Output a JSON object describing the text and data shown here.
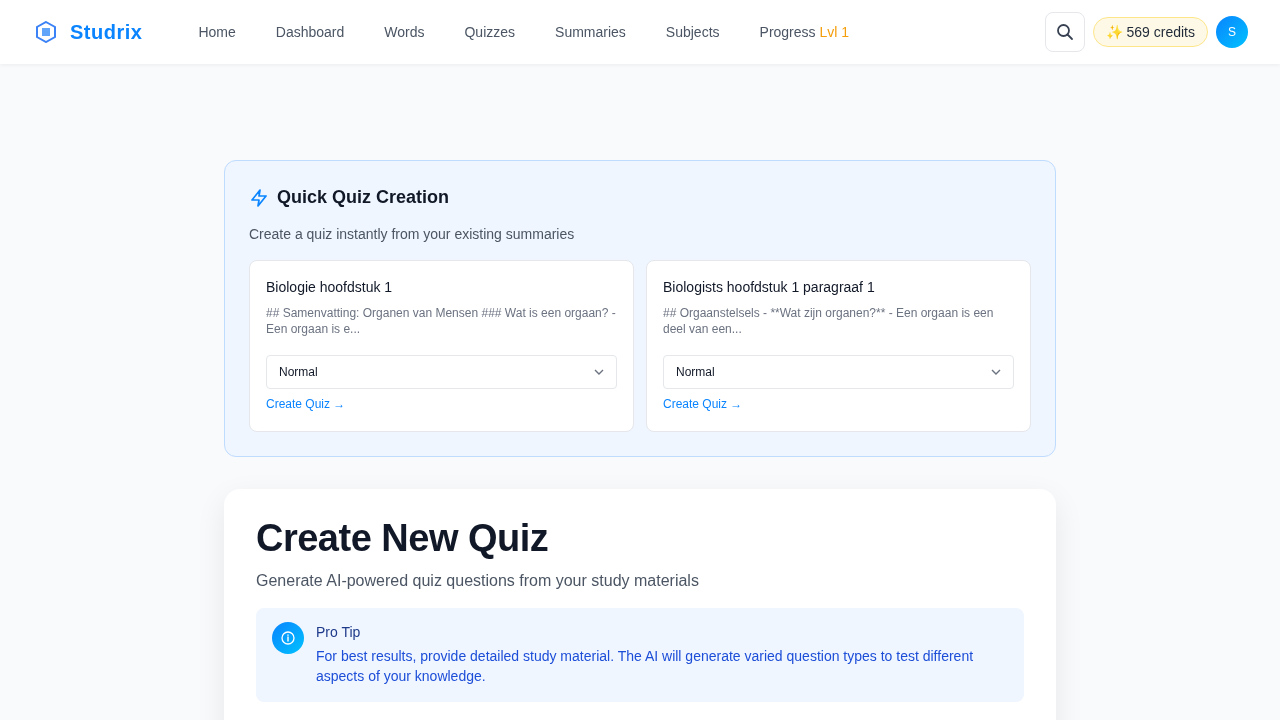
{
  "header": {
    "brand": "Studrix",
    "nav": [
      {
        "label": "Home"
      },
      {
        "label": "Dashboard"
      },
      {
        "label": "Words"
      },
      {
        "label": "Quizzes"
      },
      {
        "label": "Summaries"
      },
      {
        "label": "Subjects"
      },
      {
        "label": "Progress",
        "tag": "Lvl 1"
      }
    ],
    "credits": "✨ 569 credits",
    "avatar": "S"
  },
  "quick_quiz": {
    "title": "Quick Quiz Creation",
    "subtitle": "Create a quiz instantly from your existing summaries",
    "summaries": [
      {
        "title": "Biologie hoofdstuk 1",
        "excerpt": "## Samenvatting: Organen van Mensen ### Wat is een orgaan? - Een orgaan is e...",
        "difficulty": "Normal",
        "link": "Create Quiz →"
      },
      {
        "title": "Biologists hoofdstuk 1 paragraaf 1",
        "excerpt": "## Orgaanstelsels - **Wat zijn organen?** - Een orgaan is een deel van een...",
        "difficulty": "Normal",
        "link": "Create Quiz →"
      }
    ]
  },
  "create_quiz": {
    "title": "Create New Quiz",
    "subtitle": "Generate AI-powered quiz questions from your study materials",
    "tip": {
      "title": "Pro Tip",
      "text": "For best results, provide detailed study material. The AI will generate varied question types to test different aspects of your knowledge."
    }
  }
}
